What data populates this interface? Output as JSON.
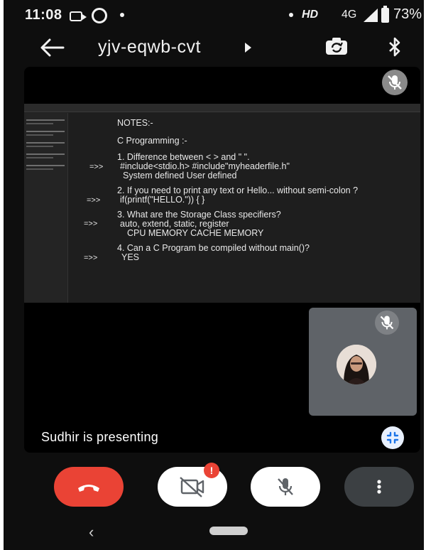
{
  "status_bar": {
    "time": "11:08",
    "hd": "HD",
    "network": "4G",
    "battery": "73%"
  },
  "header": {
    "meeting_code": "yjv-eqwb-cvt"
  },
  "shared_screen": {
    "lines": [
      {
        "text": "NOTES:-"
      },
      {
        "text": "C Programming :-"
      },
      {
        "text": "1. Difference between < > and \" \"."
      },
      {
        "text": "#include<stdio.h>         #include\"myheaderfile.h\""
      },
      {
        "text": "System defined                       User defined"
      },
      {
        "text": "2. If you need to print any text or Hello... without semi-colon ?"
      },
      {
        "text": "if(printf(\"HELLO.\")) { }"
      },
      {
        "text": "3. What are the Storage Class specifiers?"
      },
      {
        "text": "auto, extend, static,     register"
      },
      {
        "text": "CPU MEMORY          CACHE MEMORY"
      },
      {
        "text": "4. Can a C Program be compiled without main()?"
      },
      {
        "text": "YES"
      }
    ],
    "arrows": [
      "=>>",
      "=>>",
      "=>>",
      "=>>"
    ]
  },
  "presentation": {
    "presenting_text": "Sudhir is presenting"
  },
  "controls": {
    "camera_badge": "!"
  },
  "icons": {
    "back": "arrow-left-icon",
    "switch_camera": "switch-camera-icon",
    "bluetooth": "bluetooth-icon",
    "mic_off": "mic-off-icon",
    "camera_off": "camera-off-icon",
    "end_call": "phone-hangup-icon",
    "more": "more-vert-icon",
    "unpin": "collapse-icon"
  },
  "colors": {
    "end_call": "#ea4335",
    "background": "#0e0e0e",
    "self_tile": "#5f6368"
  }
}
